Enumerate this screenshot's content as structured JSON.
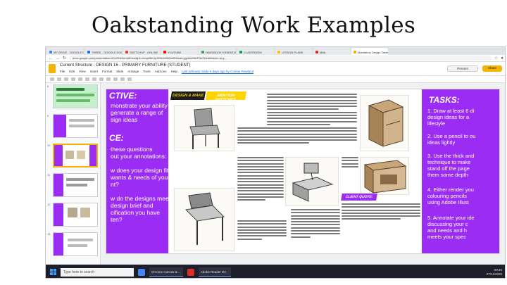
{
  "slide_title": "Oakstanding Work Examples",
  "browser": {
    "tabs": [
      {
        "label": "MY DRIVE - GOOGLE DRIVE",
        "color": "#4285f4",
        "active": false
      },
      {
        "label": "THREE - GOOGLE DOCS",
        "color": "#1a73e8",
        "active": false
      },
      {
        "label": "SKETCHUP - ONLINE",
        "color": "#ea4335",
        "active": false
      },
      {
        "label": "YOUTUBE",
        "color": "#ff0000",
        "active": false
      },
      {
        "label": "HANDBOOK ESSENTIALS",
        "color": "#34a853",
        "active": false
      },
      {
        "label": "CLASSROOM",
        "color": "#0f9d58",
        "active": false
      },
      {
        "label": "LESSON PLANS",
        "color": "#fbbc04",
        "active": false
      },
      {
        "label": "MAIL",
        "color": "#d93025",
        "active": false
      },
      {
        "label": "Mandatory Design Tasks",
        "color": "#f4b400",
        "active": true
      }
    ],
    "url": "docs.google.com/presentation/d/1vRHe5emMKtcwfg1LvhzopBhv1pSKbUvBb2w9MhsaLbyjpMnM6vP3wTs/edit#slide=id.g..."
  },
  "doc": {
    "title": "Current Structure - DESIGN 16 - PRIMARY FURNITURE (STUDENT)",
    "menus": [
      "File",
      "Edit",
      "View",
      "Insert",
      "Format",
      "Slide",
      "Arrange",
      "Tools",
      "Add-ons",
      "Help"
    ],
    "edit_note": "Last edit was made 6 days ago by Connie Rowland",
    "present_label": "Present",
    "share_label": "Share"
  },
  "filmstrip": {
    "numbers": [
      "8",
      "9",
      "10",
      "11",
      "12",
      "13"
    ]
  },
  "slide": {
    "left_panel": {
      "heading1": "CTIVE:",
      "lines1": [
        "monstrate your ability",
        "generate a range of",
        "sign ideas"
      ],
      "heading2": "CE:",
      "lines2": [
        "these questions",
        "out your annotations:",
        "",
        "w does your design fit",
        "wants & needs of your",
        "nt?",
        "",
        "w do the designs meet",
        "design brief and",
        "cification you have",
        "ten?"
      ]
    },
    "badges": {
      "design_make": "DESIGN & MAKE",
      "mention": "MENTION SKETCHES",
      "client_quote": "CLIENT QUOTE:"
    },
    "right_panel": {
      "heading": "TASKS:",
      "items": [
        "1.  Draw at least 6 di",
        "    design ideas for a",
        "    lifestyle",
        "2.  Use a pencil to ou",
        "    ideas lightly",
        "3.  Use the thick and",
        "    technique to make",
        "    stand off the page",
        "    them some depth",
        "4.  Either render you",
        "    colouring pencils",
        "    using Adobe Illust",
        "5.  Annotate your ide",
        "    discussing your c",
        "    and needs and h",
        "    meets your spec"
      ]
    }
  },
  "taskbar": {
    "search_placeholder": "Type here to search",
    "items": [
      "Chrome Canvas & ...",
      "Adobe Reader DC"
    ],
    "time": "09:25",
    "date": "07/11/2020"
  }
}
